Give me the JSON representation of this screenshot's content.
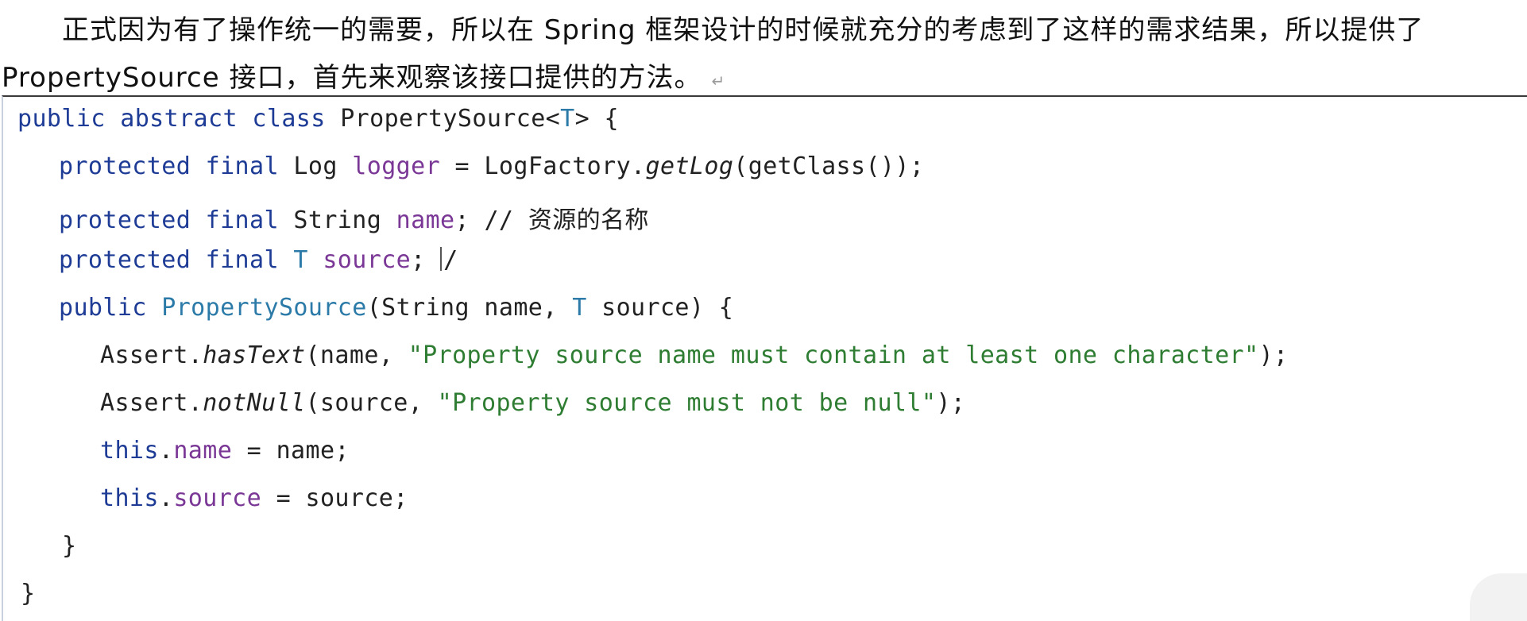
{
  "paragraph": {
    "line1": "正式因为有了操作统一的需要，所以在 Spring 框架设计的时候就充分的考虑到了这样的需求结果，所以提供了",
    "line2": "PropertySource 接口，首先来观察该接口提供的方法。"
  },
  "code": {
    "l1": {
      "kw1": "public",
      "kw2": "abstract",
      "kw3": "class",
      "name": "PropertySource<",
      "tparam": "T",
      "rest": "> {"
    },
    "l2": {
      "kw1": "protected",
      "kw2": "final",
      "type": "Log",
      "field": "logger",
      "rest1": " = LogFactory.",
      "method": "getLog",
      "rest2": "(getClass());"
    },
    "l3": {
      "kw1": "protected",
      "kw2": "final",
      "type": "String",
      "field": "name",
      "rest": "; // 资源的名称"
    },
    "l4": {
      "kw1": "protected",
      "kw2": "final",
      "tparam": "T",
      "field": "source",
      "rest": "; ",
      "slash": "/"
    },
    "l5": {
      "kw1": "public",
      "ctor": "PropertySource",
      "rest1": "(String name, ",
      "tparam": "T",
      "rest2": " source) {"
    },
    "l6": {
      "obj": "Assert.",
      "method": "hasText",
      "rest1": "(name, ",
      "str": "\"Property source name must contain at least one character\"",
      "rest2": ");"
    },
    "l7": {
      "obj": "Assert.",
      "method": "notNull",
      "rest1": "(source, ",
      "str": "\"Property source must not be null\"",
      "rest2": ");"
    },
    "l8": {
      "kw": "this",
      "dot": ".",
      "field": "name",
      "rest": " = name;"
    },
    "l9": {
      "kw": "this",
      "dot": ".",
      "field": "source",
      "rest": " = source;"
    },
    "l10": {
      "brace": "}"
    },
    "l11": {
      "brace": "}"
    }
  }
}
